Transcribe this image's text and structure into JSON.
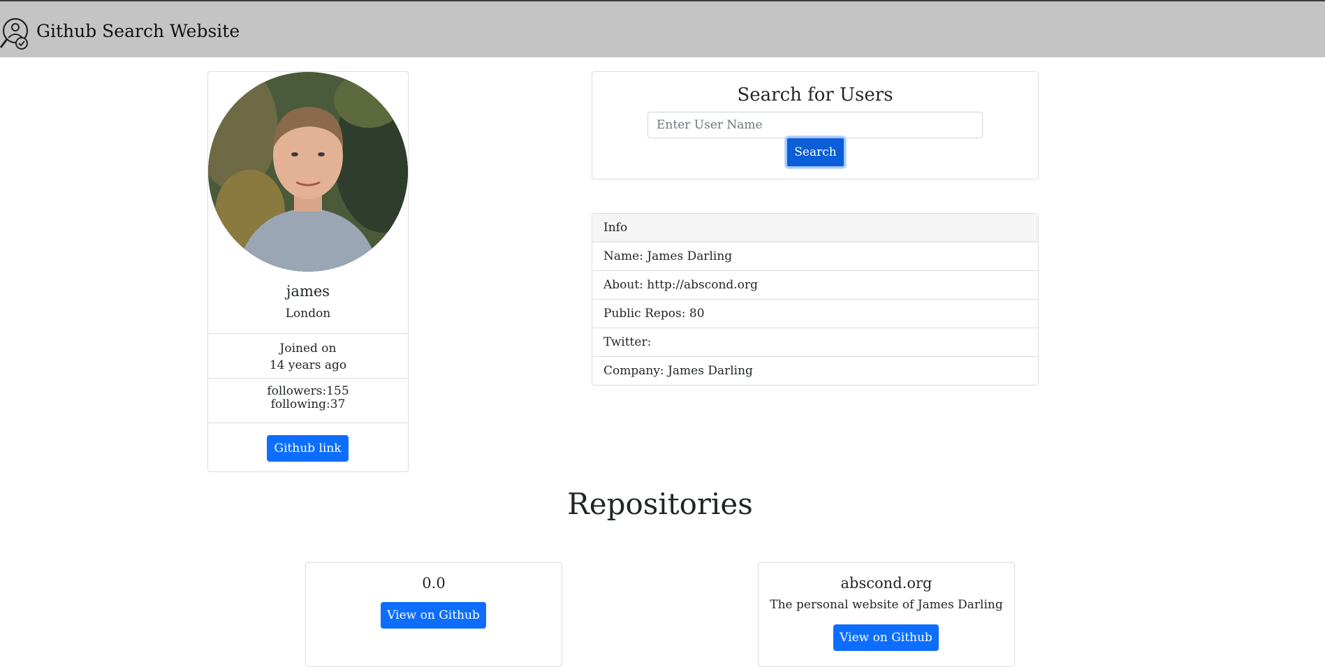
{
  "navbar": {
    "title": "Github Search Website"
  },
  "profile": {
    "login": "james",
    "location": "London",
    "joined_label": "Joined on",
    "joined_value": "14 years ago",
    "followers": "followers:155",
    "following": "following:37",
    "github_link_label": "Github link"
  },
  "search": {
    "title": "Search for Users",
    "placeholder": "Enter User Name",
    "value": "",
    "button_label": "Search"
  },
  "info": {
    "header": "Info",
    "rows": [
      "Name: James Darling",
      "About: http://abscond.org",
      "Public Repos: 80",
      "Twitter:",
      "Company: James Darling"
    ]
  },
  "repositories": {
    "title": "Repositories",
    "items": [
      {
        "name": "0.0",
        "description": "",
        "button_label": "View on Github"
      },
      {
        "name": "abscond.org",
        "description": "The personal website of James Darling",
        "button_label": "View on Github"
      }
    ]
  },
  "colors": {
    "primary": "#0d6efd",
    "navbar": "#c4c4c4",
    "border": "#dcdcdc"
  },
  "icons": {
    "brand": "user-search-icon",
    "avatar": "profile-photo"
  }
}
